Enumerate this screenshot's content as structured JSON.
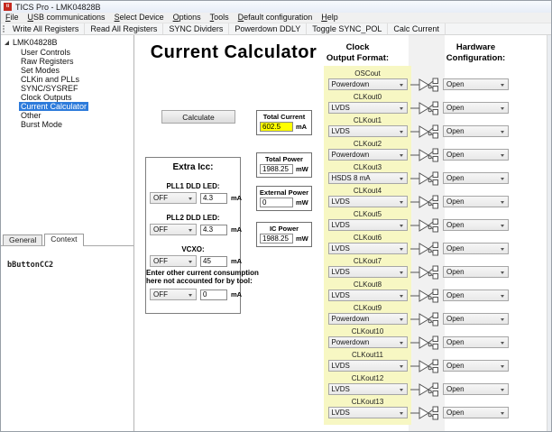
{
  "window": {
    "title": "TICS Pro - LMK04828B"
  },
  "icons": {
    "app_icon": "ti-logo-icon",
    "tree_expander": "expander-triangle-icon",
    "dropdown_chevron": "chevron-down-icon",
    "buffer_icon": "differential-buffer-icon"
  },
  "colors": {
    "selection_blue": "#2d7bdb",
    "highlight_yellow": "#ffff00",
    "panel_yellow": "#f7f7c3",
    "titlebar": "#edf2fa",
    "app_icon_red": "#c4281e"
  },
  "menu_bar": {
    "items": [
      "File",
      "USB communications",
      "Select Device",
      "Options",
      "Tools",
      "Default configuration",
      "Help"
    ]
  },
  "toolbar": {
    "buttons": [
      "Write All Registers",
      "Read All Registers",
      "SYNC Dividers",
      "Powerdown DDLY",
      "Toggle SYNC_POL",
      "Calc Current"
    ]
  },
  "sidebar": {
    "root": "LMK04828B",
    "items": [
      {
        "label": "User Controls",
        "selected": false
      },
      {
        "label": "Raw Registers",
        "selected": false
      },
      {
        "label": "Set Modes",
        "selected": false
      },
      {
        "label": "CLKin and PLLs",
        "selected": false
      },
      {
        "label": "SYNC/SYSREF",
        "selected": false
      },
      {
        "label": "Clock Outputs",
        "selected": false
      },
      {
        "label": "Current Calculator",
        "selected": true
      },
      {
        "label": "Other",
        "selected": false
      },
      {
        "label": "Burst Mode",
        "selected": false
      }
    ],
    "tabs": [
      {
        "label": "General",
        "active": false
      },
      {
        "label": "Context",
        "active": true
      }
    ],
    "context_text": "bButtonCC2"
  },
  "main": {
    "title": "Current Calculator",
    "calculate_button": "Calculate",
    "result_boxes": [
      {
        "label": "Total Current",
        "value": "602.5",
        "unit": "mA",
        "highlight": true
      },
      {
        "label": "Total Power",
        "value": "1988.25",
        "unit": "mW",
        "highlight": false
      },
      {
        "label": "External Power",
        "value": "0",
        "unit": "mW",
        "highlight": false
      },
      {
        "label": "IC Power",
        "value": "1988.25",
        "unit": "mW",
        "highlight": false
      }
    ],
    "extra_icc": {
      "title": "Extra Icc:",
      "rows": [
        {
          "label_lines": [
            "PLL1 DLD LED:"
          ],
          "select": "OFF",
          "value": "4.3",
          "unit": "mA"
        },
        {
          "label_lines": [
            "PLL2 DLD LED:"
          ],
          "select": "OFF",
          "value": "4.3",
          "unit": "mA"
        },
        {
          "label_lines": [
            "VCXO:"
          ],
          "select": "OFF",
          "value": "45",
          "unit": "mA"
        },
        {
          "label_lines": [
            "Enter other current consumption",
            "here not accounted for by tool:"
          ],
          "select": "OFF",
          "value": "0",
          "unit": "mA"
        }
      ]
    },
    "clock_output_format": {
      "header_line1": "Clock",
      "header_line2": "Output Format:",
      "rows": [
        {
          "name": "OSCout",
          "format": "Powerdown"
        },
        {
          "name": "CLKout0",
          "format": "LVDS"
        },
        {
          "name": "CLKout1",
          "format": "LVDS"
        },
        {
          "name": "CLKout2",
          "format": "Powerdown"
        },
        {
          "name": "CLKout3",
          "format": "HSDS 8 mA"
        },
        {
          "name": "CLKout4",
          "format": "LVDS"
        },
        {
          "name": "CLKout5",
          "format": "LVDS"
        },
        {
          "name": "CLKout6",
          "format": "LVDS"
        },
        {
          "name": "CLKout7",
          "format": "LVDS"
        },
        {
          "name": "CLKout8",
          "format": "LVDS"
        },
        {
          "name": "CLKout9",
          "format": "Powerdown"
        },
        {
          "name": "CLKout10",
          "format": "Powerdown"
        },
        {
          "name": "CLKout11",
          "format": "LVDS"
        },
        {
          "name": "CLKout12",
          "format": "LVDS"
        },
        {
          "name": "CLKout13",
          "format": "LVDS"
        }
      ]
    },
    "hardware_configuration": {
      "header_line1": "Hardware",
      "header_line2": "Configuration:",
      "rows": [
        "Open",
        "Open",
        "Open",
        "Open",
        "Open",
        "Open",
        "Open",
        "Open",
        "Open",
        "Open",
        "Open",
        "Open",
        "Open",
        "Open",
        "Open"
      ]
    }
  }
}
